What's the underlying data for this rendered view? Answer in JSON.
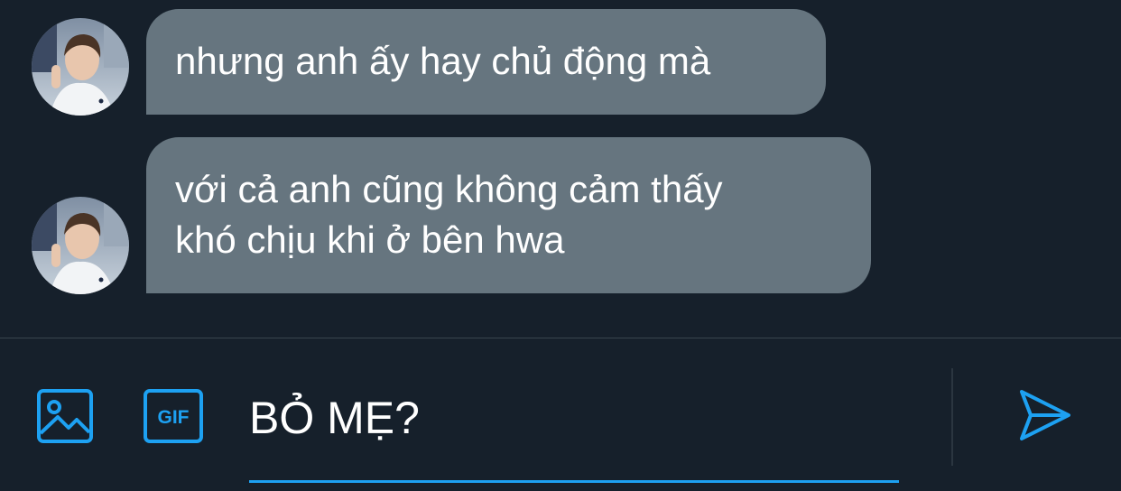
{
  "messages": [
    {
      "sender_avatar": "avatar-photo",
      "lines": [
        "nhưng anh ấy hay chủ động mà"
      ]
    },
    {
      "sender_avatar": "avatar-photo",
      "lines": [
        "với cả anh cũng không cảm thấy",
        "khó chịu khi ở bên hwa"
      ]
    }
  ],
  "composer": {
    "value": "BỎ MẸ?",
    "gif_label": "GIF",
    "image_icon": "image-icon",
    "gif_icon": "gif-icon",
    "send_icon": "send-icon"
  },
  "colors": {
    "background": "#16202b",
    "bubble": "#66757f",
    "accent": "#1da1f2",
    "text": "#ffffff",
    "divider": "#38444d"
  }
}
